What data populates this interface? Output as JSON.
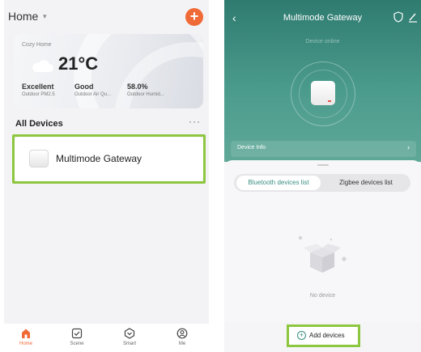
{
  "home": {
    "title": "Home",
    "caret": "▾",
    "add": "+",
    "weather": {
      "home_name": "Cozy Home",
      "temperature": "21°C",
      "stats": [
        {
          "value": "Excellent",
          "label": "Outdoor PM2.5"
        },
        {
          "value": "Good",
          "label": "Outdoor Air Qu..."
        },
        {
          "value": "58.0%",
          "label": "Outdoor Humid..."
        }
      ]
    },
    "section_title": "All Devices",
    "more": "···",
    "devices": [
      {
        "name": "Multimode Gateway"
      }
    ],
    "tabs": [
      {
        "label": "Home",
        "active": true
      },
      {
        "label": "Scene",
        "active": false
      },
      {
        "label": "Smart",
        "active": false
      },
      {
        "label": "Me",
        "active": false
      }
    ]
  },
  "gateway": {
    "title": "Multimode Gateway",
    "back": "‹",
    "status": "Device online",
    "device_info": "Device Info",
    "chevron": "›",
    "segments": [
      "Bluetooth devices list",
      "Zigbee devices list"
    ],
    "empty": "No device",
    "add_label": "Add devices",
    "add_plus": "+"
  },
  "colors": {
    "accent": "#f06a37",
    "teal": "#3a8e80",
    "highlight": "#8dc63f"
  }
}
